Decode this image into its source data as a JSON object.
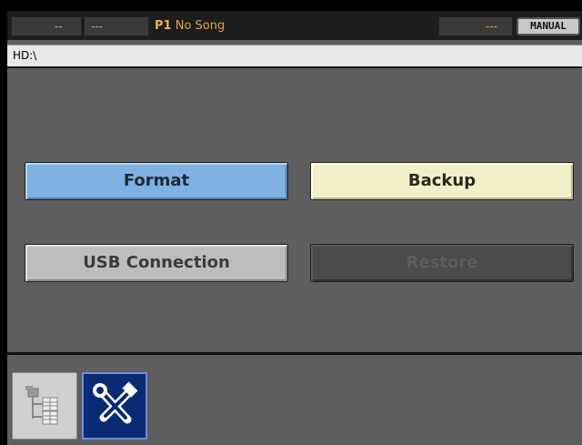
{
  "status_bar": {
    "seg1": "--",
    "seg2": "---",
    "program": "P1",
    "song": "No Song",
    "seg_right": "---",
    "mode": "MANUAL"
  },
  "path": "HD:\\",
  "buttons": {
    "format": "Format",
    "backup": "Backup",
    "usb_connection": "USB Connection",
    "restore": "Restore"
  },
  "toolbar": {
    "tabs": [
      {
        "icon": "file-tree-icon",
        "active": false
      },
      {
        "icon": "tools-icon",
        "active": true
      }
    ]
  }
}
